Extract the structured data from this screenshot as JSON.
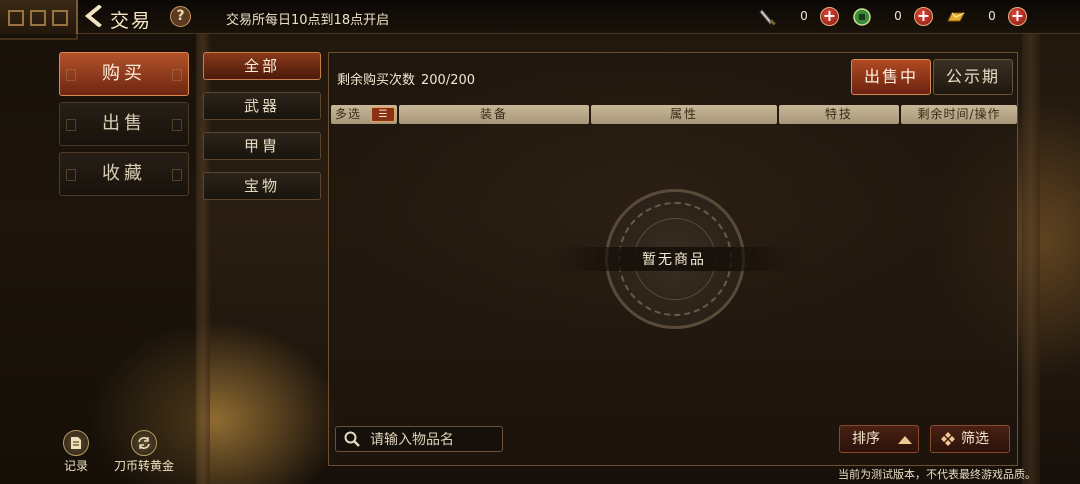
{
  "header": {
    "title": "交易",
    "back_icon": "back-arrow-icon",
    "help_label": "?",
    "notice": "交易所每日10点到18点开启",
    "currencies": [
      {
        "icon": "blade-coin-icon",
        "value": "0",
        "plus": "+"
      },
      {
        "icon": "jade-coin-icon",
        "value": "0",
        "plus": "+"
      },
      {
        "icon": "gold-ingot-icon",
        "value": "0",
        "plus": "+"
      }
    ]
  },
  "left_menu": {
    "items": [
      {
        "label": "购买",
        "active": true
      },
      {
        "label": "出售",
        "active": false
      },
      {
        "label": "收藏",
        "active": false
      }
    ],
    "tools": [
      {
        "icon": "document-icon",
        "label": "记录"
      },
      {
        "icon": "exchange-icon",
        "label": "刀币转黄金"
      }
    ]
  },
  "categories": [
    {
      "label": "全部",
      "active": true
    },
    {
      "label": "武器",
      "active": false
    },
    {
      "label": "甲胄",
      "active": false
    },
    {
      "label": "宝物",
      "active": false
    }
  ],
  "panel": {
    "remaining_label": "剩余购买次数",
    "remaining_value": "200/200",
    "status_tabs": [
      {
        "label": "出售中",
        "active": true
      },
      {
        "label": "公示期",
        "active": false
      }
    ],
    "columns": [
      "多选",
      "装备",
      "属性",
      "特技",
      "剩余时间/操作"
    ],
    "empty_text": "暂无商品",
    "search_placeholder": "请输入物品名",
    "sort_label": "排序",
    "filter_label": "筛选"
  },
  "footer": {
    "disclaimer": "当前为测试版本，不代表最终游戏品质。"
  },
  "colors": {
    "accent": "#b04a22",
    "header_cell": "#c8b898",
    "panel_border": "#6a5030"
  }
}
